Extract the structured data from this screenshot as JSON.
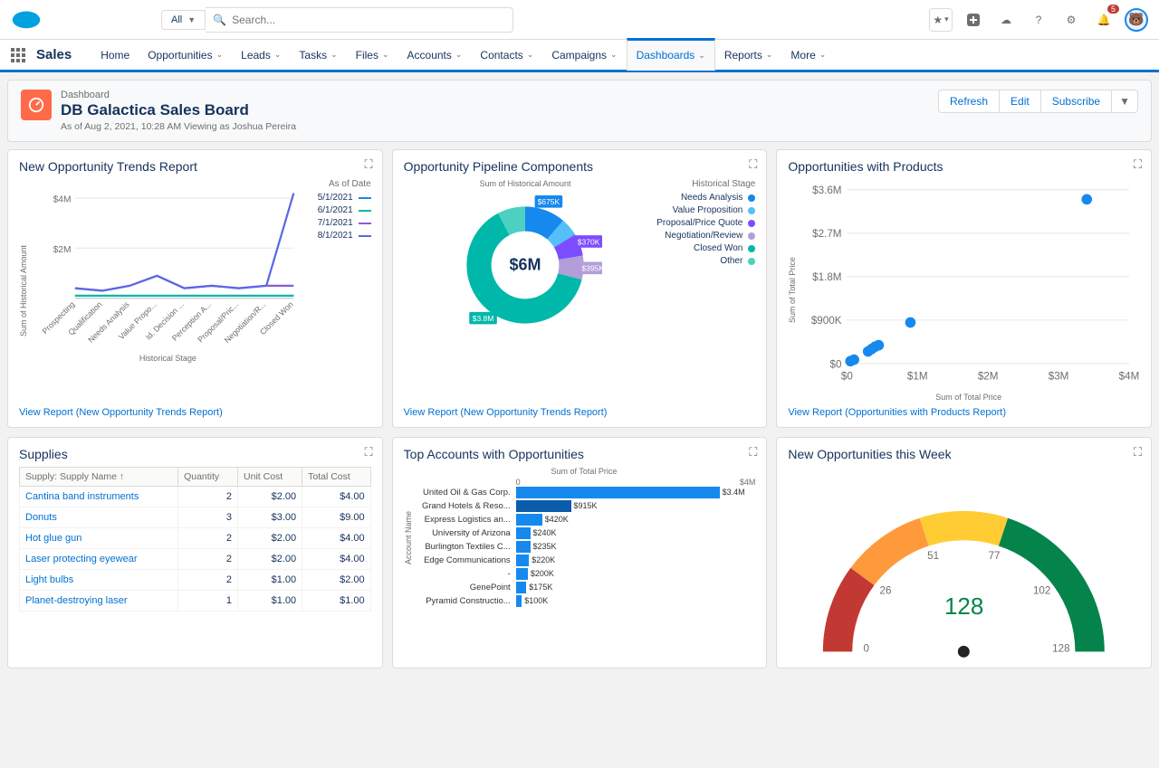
{
  "topbar": {
    "scope_label": "All",
    "search_placeholder": "Search...",
    "notification_count": "5"
  },
  "navbar": {
    "app_name": "Sales",
    "items": [
      {
        "label": "Home",
        "dropdown": false
      },
      {
        "label": "Opportunities",
        "dropdown": true
      },
      {
        "label": "Leads",
        "dropdown": true
      },
      {
        "label": "Tasks",
        "dropdown": true
      },
      {
        "label": "Files",
        "dropdown": true
      },
      {
        "label": "Accounts",
        "dropdown": true
      },
      {
        "label": "Contacts",
        "dropdown": true
      },
      {
        "label": "Campaigns",
        "dropdown": true
      },
      {
        "label": "Dashboards",
        "dropdown": true,
        "active": true
      },
      {
        "label": "Reports",
        "dropdown": true
      },
      {
        "label": "More",
        "dropdown": true
      }
    ]
  },
  "header": {
    "object_type": "Dashboard",
    "title": "DB Galactica Sales Board",
    "subtitle": "As of Aug 2, 2021, 10:28 AM Viewing as Joshua Pereira",
    "actions": {
      "refresh": "Refresh",
      "edit": "Edit",
      "subscribe": "Subscribe"
    }
  },
  "cards": {
    "trends": {
      "title": "New Opportunity Trends Report",
      "view_link": "View Report (New Opportunity Trends Report)",
      "y_label": "Sum of Historical Amount",
      "x_label": "Historical Stage",
      "legend_title": "As of Date",
      "legend": [
        "5/1/2021",
        "6/1/2021",
        "7/1/2021",
        "8/1/2021"
      ]
    },
    "pipeline": {
      "title": "Opportunity Pipeline Components",
      "view_link": "View Report (New Opportunity Trends Report)",
      "donut_title": "Sum of Historical Amount",
      "center": "$6M",
      "legend_title": "Historical Stage",
      "legend": [
        "Needs Analysis",
        "Value Proposition",
        "Proposal/Price Quote",
        "Negotiation/Review",
        "Closed Won",
        "Other"
      ]
    },
    "oppprod": {
      "title": "Opportunities with Products",
      "view_link": "View Report (Opportunities with Products Report)",
      "y_label": "Sum of Total Price",
      "x_label": "Sum of Total Price",
      "y_ticks": [
        "$3.6M",
        "$2.7M",
        "$1.8M",
        "$900K",
        "$0"
      ],
      "x_ticks": [
        "$0",
        "$1M",
        "$2M",
        "$3M",
        "$4M"
      ]
    },
    "supplies": {
      "title": "Supplies",
      "columns": [
        "Supply: Supply Name ↑",
        "Quantity",
        "Unit Cost",
        "Total Cost"
      ],
      "rows": [
        {
          "name": "Cantina band instruments",
          "qty": "2",
          "unit": "$2.00",
          "total": "$4.00"
        },
        {
          "name": "Donuts",
          "qty": "3",
          "unit": "$3.00",
          "total": "$9.00"
        },
        {
          "name": "Hot glue gun",
          "qty": "2",
          "unit": "$2.00",
          "total": "$4.00"
        },
        {
          "name": "Laser protecting eyewear",
          "qty": "2",
          "unit": "$2.00",
          "total": "$4.00"
        },
        {
          "name": "Light bulbs",
          "qty": "2",
          "unit": "$1.00",
          "total": "$2.00"
        },
        {
          "name": "Planet-destroying laser",
          "qty": "1",
          "unit": "$1.00",
          "total": "$1.00"
        }
      ]
    },
    "topacct": {
      "title": "Top Accounts with Opportunities",
      "x_title": "Sum of Total Price",
      "y_label": "Account Name",
      "x_ticks": [
        "0",
        "$4M"
      ],
      "rows": [
        {
          "name": "United Oil & Gas Corp.",
          "val": "$3.4M",
          "pct": 85
        },
        {
          "name": "Grand Hotels & Reso...",
          "val": "$915K",
          "pct": 23,
          "alt": true
        },
        {
          "name": "Express Logistics an...",
          "val": "$420K",
          "pct": 11
        },
        {
          "name": "University of Arizona",
          "val": "$240K",
          "pct": 6
        },
        {
          "name": "Burlington Textiles C...",
          "val": "$235K",
          "pct": 6
        },
        {
          "name": "Edge Communications",
          "val": "$220K",
          "pct": 5.5
        },
        {
          "name": "-",
          "val": "$200K",
          "pct": 5
        },
        {
          "name": "GenePoint",
          "val": "$175K",
          "pct": 4.4
        },
        {
          "name": "Pyramid Constructio...",
          "val": "$100K",
          "pct": 2.5
        }
      ]
    },
    "gauge": {
      "title": "New Opportunities this Week",
      "value": "128",
      "ticks": [
        "0",
        "26",
        "51",
        "77",
        "102",
        "128"
      ]
    }
  },
  "chart_data": [
    {
      "type": "line",
      "title": "New Opportunity Trends Report",
      "xlabel": "Historical Stage",
      "ylabel": "Sum of Historical Amount",
      "categories": [
        "Prospecting",
        "Qualification",
        "Needs Analysis",
        "Value Propo...",
        "Id. Decision ...",
        "Perception A...",
        "Proposal/Pric...",
        "Negotiation/R...",
        "Closed Won"
      ],
      "y_ticks": [
        "$2M",
        "$4M"
      ],
      "series": [
        {
          "name": "5/1/2021",
          "color": "#1589ee",
          "values": [
            0.1,
            0.1,
            0.1,
            0.1,
            0.1,
            0.1,
            0.1,
            0.1,
            0.1
          ]
        },
        {
          "name": "6/1/2021",
          "color": "#00b8a9",
          "values": [
            0.1,
            0.1,
            0.1,
            0.1,
            0.1,
            0.1,
            0.1,
            0.1,
            0.1
          ]
        },
        {
          "name": "7/1/2021",
          "color": "#8a5cd6",
          "values": [
            0.4,
            0.3,
            0.5,
            0.9,
            0.4,
            0.5,
            0.4,
            0.5,
            0.5
          ]
        },
        {
          "name": "8/1/2021",
          "color": "#5867e8",
          "values": [
            0.4,
            0.3,
            0.5,
            0.9,
            0.4,
            0.5,
            0.4,
            0.5,
            4.2
          ]
        }
      ],
      "ylim": [
        0,
        4.5
      ]
    },
    {
      "type": "pie",
      "title": "Opportunity Pipeline Components",
      "center_label": "$6M",
      "slices": [
        {
          "name": "Needs Analysis",
          "value": 675,
          "label": "$675K",
          "color": "#1589ee"
        },
        {
          "name": "Value Proposition",
          "value": 300,
          "color": "#54c0f7"
        },
        {
          "name": "Proposal/Price Quote",
          "value": 370,
          "label": "$370K",
          "color": "#7c4dff"
        },
        {
          "name": "Negotiation/Review",
          "value": 395,
          "label": "$395K",
          "color": "#b39ddb"
        },
        {
          "name": "Closed Won",
          "value": 3800,
          "label": "$3.8M",
          "color": "#00b8a9"
        },
        {
          "name": "Other",
          "value": 460,
          "color": "#4dd0c0"
        }
      ]
    },
    {
      "type": "scatter",
      "title": "Opportunities with Products",
      "xlabel": "Sum of Total Price",
      "ylabel": "Sum of Total Price",
      "xlim": [
        0,
        4
      ],
      "ylim": [
        0,
        3.6
      ],
      "points": [
        [
          0.05,
          0.05
        ],
        [
          0.1,
          0.08
        ],
        [
          0.3,
          0.25
        ],
        [
          0.35,
          0.3
        ],
        [
          0.4,
          0.35
        ],
        [
          0.45,
          0.38
        ],
        [
          0.9,
          0.85
        ],
        [
          3.4,
          3.4
        ]
      ]
    },
    {
      "type": "table",
      "title": "Supplies",
      "columns": [
        "Supply: Supply Name",
        "Quantity",
        "Unit Cost",
        "Total Cost"
      ],
      "rows": [
        [
          "Cantina band instruments",
          2,
          2.0,
          4.0
        ],
        [
          "Donuts",
          3,
          3.0,
          9.0
        ],
        [
          "Hot glue gun",
          2,
          2.0,
          4.0
        ],
        [
          "Laser protecting eyewear",
          2,
          2.0,
          4.0
        ],
        [
          "Light bulbs",
          2,
          1.0,
          2.0
        ],
        [
          "Planet-destroying laser",
          1,
          1.0,
          1.0
        ]
      ]
    },
    {
      "type": "bar",
      "orientation": "horizontal",
      "title": "Top Accounts with Opportunities",
      "xlabel": "Sum of Total Price",
      "xlim": [
        0,
        4000000
      ],
      "categories": [
        "United Oil & Gas Corp.",
        "Grand Hotels & Reso...",
        "Express Logistics an...",
        "University of Arizona",
        "Burlington Textiles C...",
        "Edge Communications",
        "-",
        "GenePoint",
        "Pyramid Constructio..."
      ],
      "values": [
        3400000,
        915000,
        420000,
        240000,
        235000,
        220000,
        200000,
        175000,
        100000
      ]
    },
    {
      "type": "gauge",
      "title": "New Opportunities this Week",
      "value": 128,
      "min": 0,
      "max": 128,
      "segments": [
        {
          "from": 0,
          "to": 26,
          "color": "#c23934"
        },
        {
          "from": 26,
          "to": 51,
          "color": "#ff9a3c"
        },
        {
          "from": 51,
          "to": 77,
          "color": "#ffcc33"
        },
        {
          "from": 77,
          "to": 128,
          "color": "#04844b"
        }
      ]
    }
  ],
  "colors": {
    "legend_lines": [
      "#1589ee",
      "#00b8a9",
      "#8a5cd6",
      "#5867e8"
    ],
    "legend_dots": [
      "#1589ee",
      "#54c0f7",
      "#7c4dff",
      "#b39ddb",
      "#00b8a9",
      "#4dd0c0"
    ]
  }
}
